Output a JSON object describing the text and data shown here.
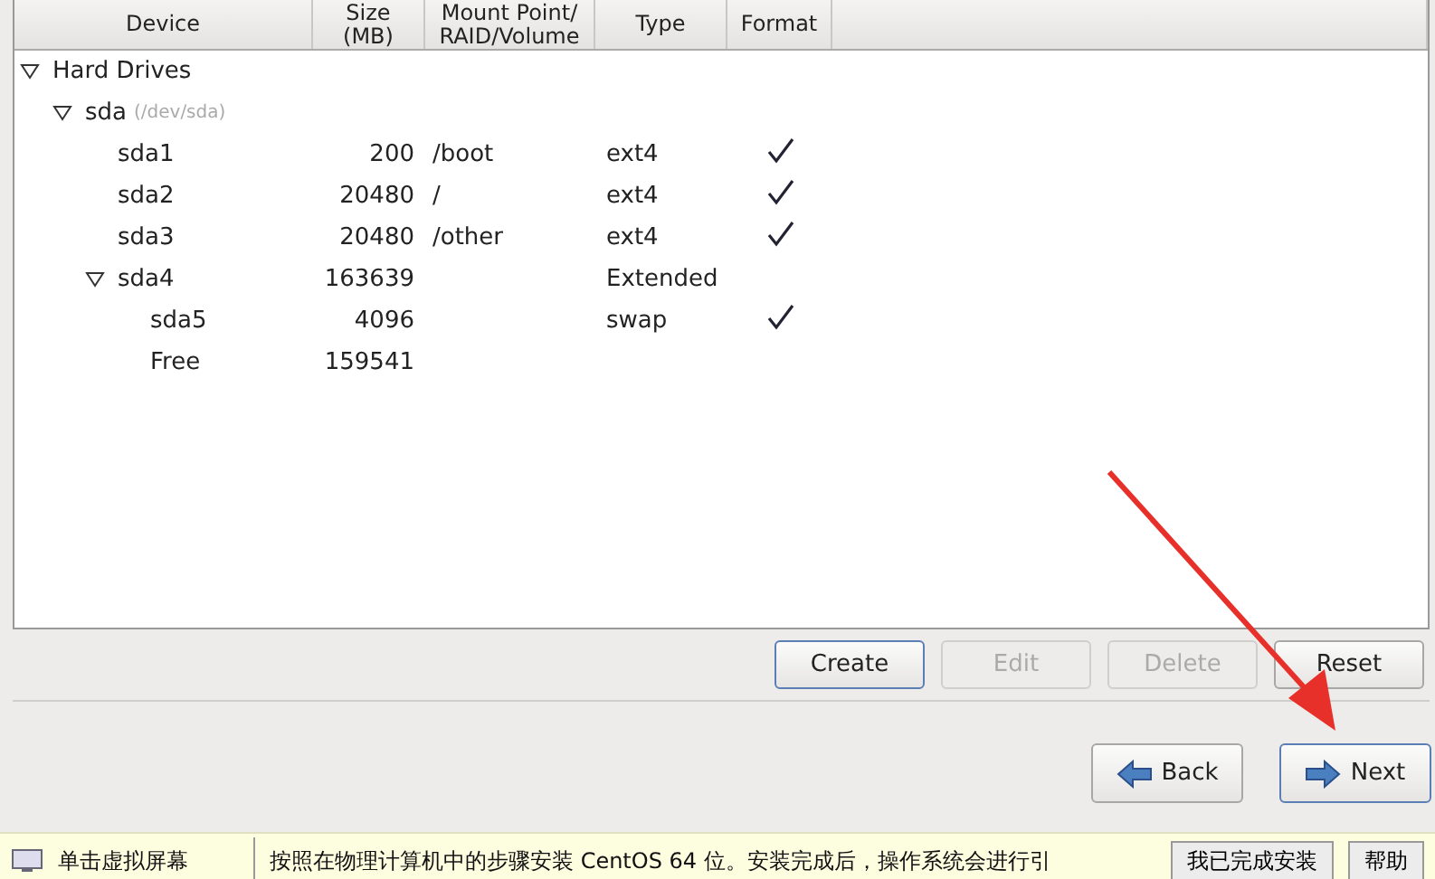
{
  "table": {
    "columns": [
      {
        "lines": [
          "Device"
        ]
      },
      {
        "lines": [
          "Size",
          "(MB)"
        ]
      },
      {
        "lines": [
          "Mount Point/",
          "RAID/Volume"
        ]
      },
      {
        "lines": [
          "Type"
        ]
      },
      {
        "lines": [
          "Format"
        ]
      }
    ],
    "tree": [
      {
        "device": "Hard Drives",
        "expanded": true,
        "children": [
          {
            "device": "sda",
            "path": "(/dev/sda)",
            "expanded": true,
            "children": [
              {
                "device": "sda1",
                "size": "200",
                "mount": "/boot",
                "type": "ext4",
                "format": true
              },
              {
                "device": "sda2",
                "size": "20480",
                "mount": "/",
                "type": "ext4",
                "format": true
              },
              {
                "device": "sda3",
                "size": "20480",
                "mount": "/other",
                "type": "ext4",
                "format": true
              },
              {
                "device": "sda4",
                "size": "163639",
                "type": "Extended",
                "format": false,
                "expanded": true,
                "children": [
                  {
                    "device": "sda5",
                    "size": "4096",
                    "type": "swap",
                    "format": true
                  },
                  {
                    "device": "Free",
                    "size": "159541",
                    "format": false
                  }
                ]
              }
            ]
          }
        ]
      }
    ]
  },
  "partition_buttons": [
    {
      "label": "Create",
      "disabled": false,
      "focused": true
    },
    {
      "label": "Edit",
      "disabled": true,
      "focused": false
    },
    {
      "label": "Delete",
      "disabled": true,
      "focused": false
    },
    {
      "label": "Reset",
      "disabled": false,
      "focused": false
    }
  ],
  "nav_buttons": [
    {
      "label": "Back",
      "kind": "back",
      "focused": false
    },
    {
      "label": "Next",
      "kind": "next",
      "focused": true
    }
  ],
  "hint_bar": {
    "title": "单击虚拟屏幕",
    "message": "按照在物理计算机中的步骤安装 CentOS 64 位。安装完成后，操作系统会进行引",
    "buttons": [
      "我已完成安装",
      "帮助"
    ]
  }
}
